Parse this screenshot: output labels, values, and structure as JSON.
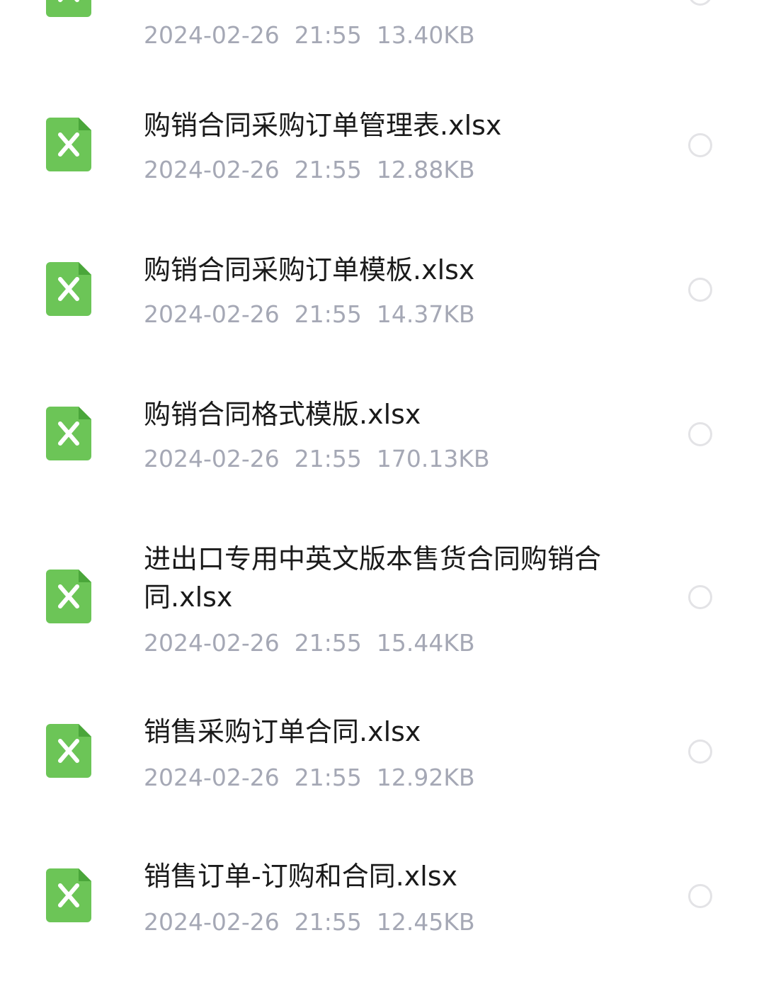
{
  "files": [
    {
      "name": "",
      "date": "2024-02-26",
      "time": "21:55",
      "size": "13.40KB",
      "icon": "excel-file-icon"
    },
    {
      "name": "购销合同采购订单管理表.xlsx",
      "date": "2024-02-26",
      "time": "21:55",
      "size": "12.88KB",
      "icon": "excel-file-icon"
    },
    {
      "name": "购销合同采购订单模板.xlsx",
      "date": "2024-02-26",
      "time": "21:55",
      "size": "14.37KB",
      "icon": "excel-file-icon"
    },
    {
      "name": "购销合同格式模版.xlsx",
      "date": "2024-02-26",
      "time": "21:55",
      "size": "170.13KB",
      "icon": "excel-file-icon"
    },
    {
      "name": "进出口专用中英文版本售货合同购销合同.xlsx",
      "date": "2024-02-26",
      "time": "21:55",
      "size": "15.44KB",
      "icon": "excel-file-icon"
    },
    {
      "name": "销售采购订单合同.xlsx",
      "date": "2024-02-26",
      "time": "21:55",
      "size": "12.92KB",
      "icon": "excel-file-icon"
    },
    {
      "name": "销售订单-订购和合同.xlsx",
      "date": "2024-02-26",
      "time": "21:55",
      "size": "12.45KB",
      "icon": "excel-file-icon"
    },
    {
      "name": "",
      "date": "",
      "time": "",
      "size": "",
      "icon": "excel-file-icon"
    }
  ],
  "colors": {
    "icon_green": "#6cc557",
    "name_text": "#1a1a1a",
    "meta_text": "#a5a8b5",
    "radio_border": "#e3e3e6"
  }
}
